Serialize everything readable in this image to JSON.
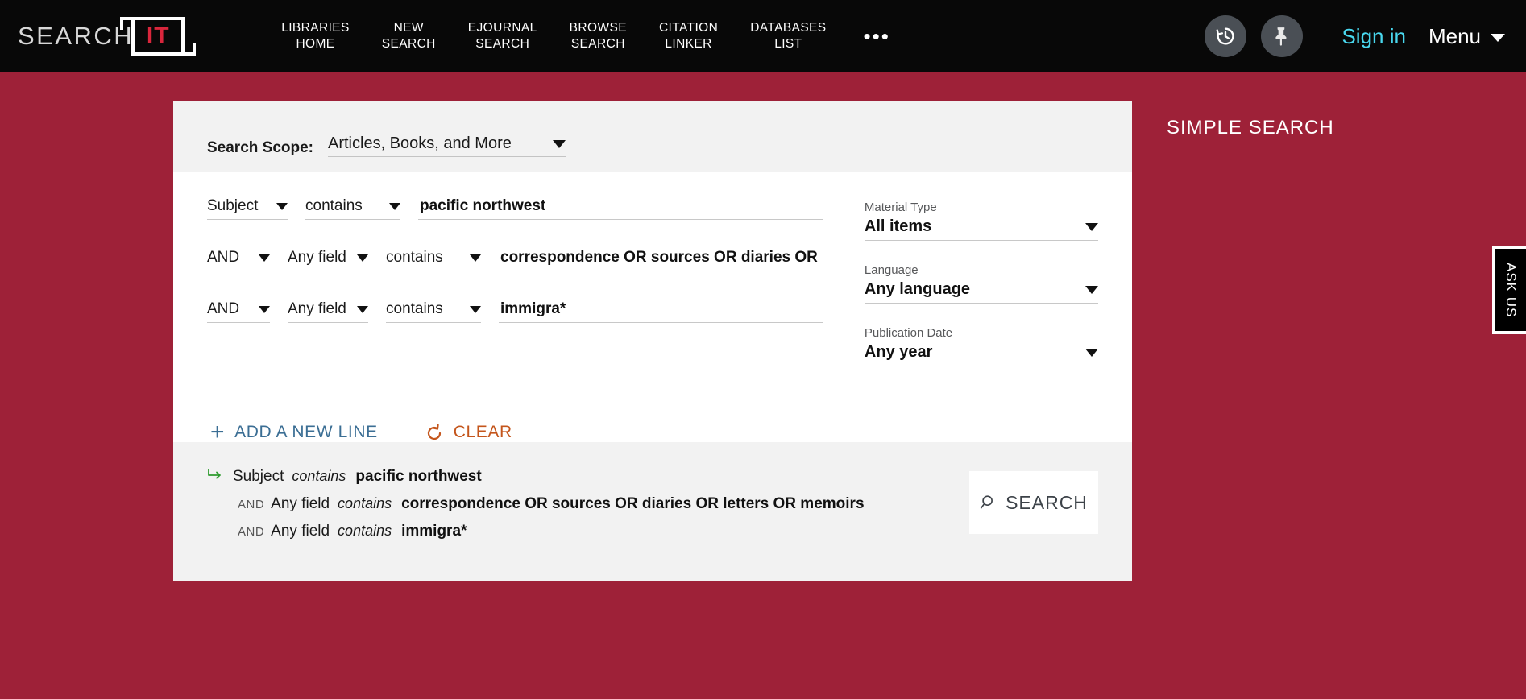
{
  "header": {
    "logo": {
      "word": "SEARCH",
      "mark": "IT"
    },
    "nav": [
      {
        "label": "LIBRARIES\nHOME"
      },
      {
        "label": "NEW\nSEARCH"
      },
      {
        "label": "EJOURNAL\nSEARCH"
      },
      {
        "label": "BROWSE\nSEARCH"
      },
      {
        "label": "CITATION\nLINKER"
      },
      {
        "label": "DATABASES\nLIST"
      }
    ],
    "more_label": "•••",
    "history_icon": "history-clock-icon",
    "pin_icon": "pin-icon",
    "sign_in_label": "Sign in",
    "menu_label": "Menu",
    "accent_signin": "#49d8ef",
    "background": "#080808"
  },
  "page": {
    "background": "#9e2138",
    "simple_search_label": "SIMPLE SEARCH",
    "ask_us_label": "ASK US"
  },
  "scope": {
    "label": "Search Scope:",
    "value": "Articles, Books, and More"
  },
  "rows": [
    {
      "bool": null,
      "field": "Subject",
      "operator": "contains",
      "value": "pacific northwest",
      "placeholder": ""
    },
    {
      "bool": "AND",
      "field": "Any field",
      "operator": "contains",
      "value": "correspondence OR sources OR diaries OR letters OR memoirs",
      "placeholder": ""
    },
    {
      "bool": "AND",
      "field": "Any field",
      "operator": "contains",
      "value": "immigra*",
      "placeholder": ""
    }
  ],
  "facets": [
    {
      "label": "Material Type",
      "value": "All items"
    },
    {
      "label": "Language",
      "value": "Any language"
    },
    {
      "label": "Publication Date",
      "value": "Any year"
    }
  ],
  "actions": {
    "add_line_label": "ADD A NEW LINE",
    "add_line_icon": "plus-icon",
    "clear_label": "CLEAR",
    "clear_icon": "undo-arrow-icon",
    "add_color": "#3b6e94",
    "clear_color": "#c4551b"
  },
  "summary": {
    "arrow_icon": "green-arrow-icon",
    "lines": [
      {
        "bool": "",
        "field": "Subject",
        "operator": "contains",
        "value": "pacific northwest"
      },
      {
        "bool": "AND",
        "field": "Any field",
        "operator": "contains",
        "value": "correspondence OR sources OR diaries OR letters OR memoirs"
      },
      {
        "bool": "AND",
        "field": "Any field",
        "operator": "contains",
        "value": "immigra*"
      }
    ],
    "search_button_label": "SEARCH",
    "search_icon": "magnifier-icon"
  }
}
